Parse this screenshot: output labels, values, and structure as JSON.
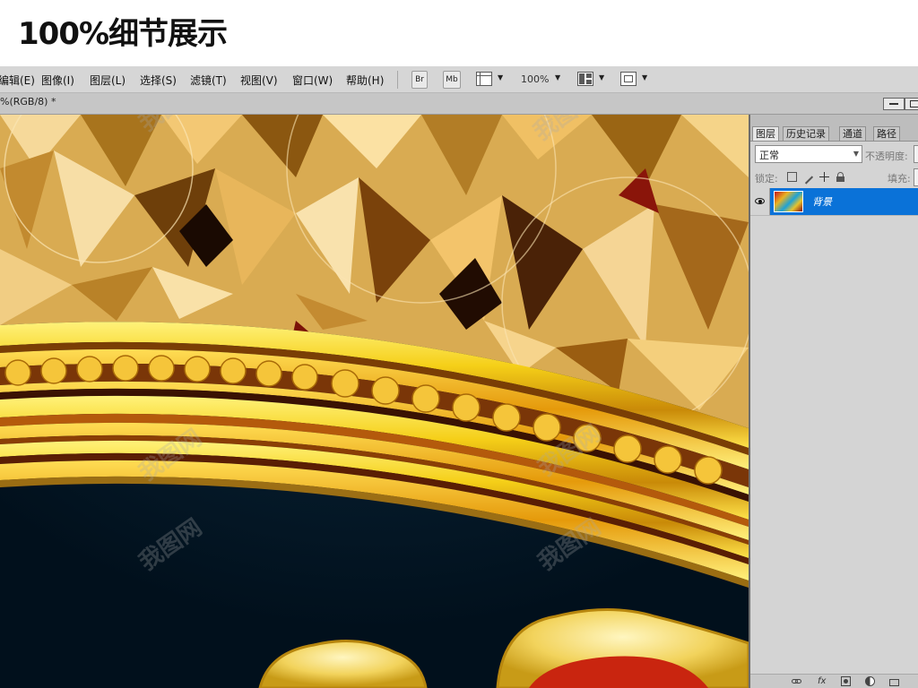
{
  "header": {
    "title": "100%细节展示"
  },
  "menubar": {
    "items": [
      "编辑(E)",
      "图像(I)",
      "图层(L)",
      "选择(S)",
      "滤镜(T)",
      "视图(V)",
      "窗口(W)",
      "帮助(H)"
    ],
    "bridge_label": "Br",
    "minibridge_label": "Mb",
    "zoom": "100%",
    "icons": [
      "view-extras-icon",
      "arrange-documents-icon",
      "screen-mode-icon"
    ]
  },
  "document": {
    "tab_label": "%(RGB/8) *"
  },
  "layers_panel": {
    "tabs": [
      "图层",
      "历史记录",
      "通道",
      "路径"
    ],
    "active_tab": "图层",
    "blend_mode": "正常",
    "opacity_label": "不透明度:",
    "lock_label": "锁定:",
    "fill_label": "填充:",
    "layer": {
      "name": "背景",
      "visible": true,
      "selected": true
    },
    "footer_icons": [
      "link-layers-icon",
      "fx-icon",
      "add-mask-icon",
      "adjustment-layer-icon",
      "new-group-icon"
    ]
  },
  "watermark": {
    "text": "我图网"
  },
  "colors": {
    "selection": "#0a72d8",
    "gold": "#f0c63a",
    "navy": "#031320"
  }
}
